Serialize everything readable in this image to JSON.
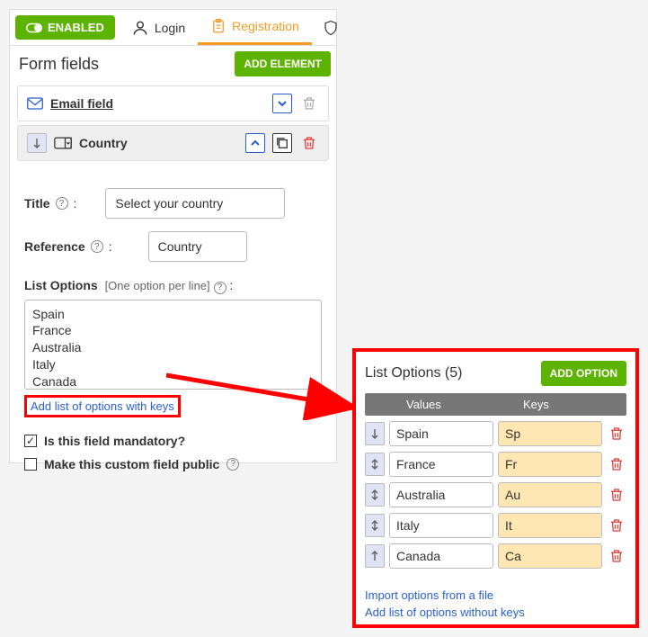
{
  "tabs": {
    "enabled": "ENABLED",
    "login": "Login",
    "registration": "Registration"
  },
  "section": {
    "title": "Form fields",
    "addBtn": "ADD ELEMENT"
  },
  "fields": [
    {
      "label": "Email field"
    },
    {
      "label": "Country"
    }
  ],
  "props": {
    "titleLabel": "Title",
    "titleValue": "Select your country",
    "refLabel": "Reference",
    "refValue": "Country",
    "listLabel": "List Options",
    "listHint": "[One option per line]",
    "addKeysLink": "Add list of options with keys",
    "mandatory": "Is this field mandatory?",
    "publicField": "Make this custom field public"
  },
  "listOptionsRaw": "Spain\nFrance\nAustralia\nItaly\nCanada",
  "listPanel": {
    "title": "List Options (5)",
    "addBtn": "ADD OPTION",
    "colValues": "Values",
    "colKeys": "Keys",
    "rows": [
      {
        "value": "Spain",
        "key": "Sp",
        "handle": "down"
      },
      {
        "value": "France",
        "key": "Fr",
        "handle": "both"
      },
      {
        "value": "Australia",
        "key": "Au",
        "handle": "both"
      },
      {
        "value": "Italy",
        "key": "It",
        "handle": "both"
      },
      {
        "value": "Canada",
        "key": "Ca",
        "handle": "up"
      }
    ],
    "importLink": "Import options from a file",
    "noKeysLink": "Add list of options without keys"
  }
}
